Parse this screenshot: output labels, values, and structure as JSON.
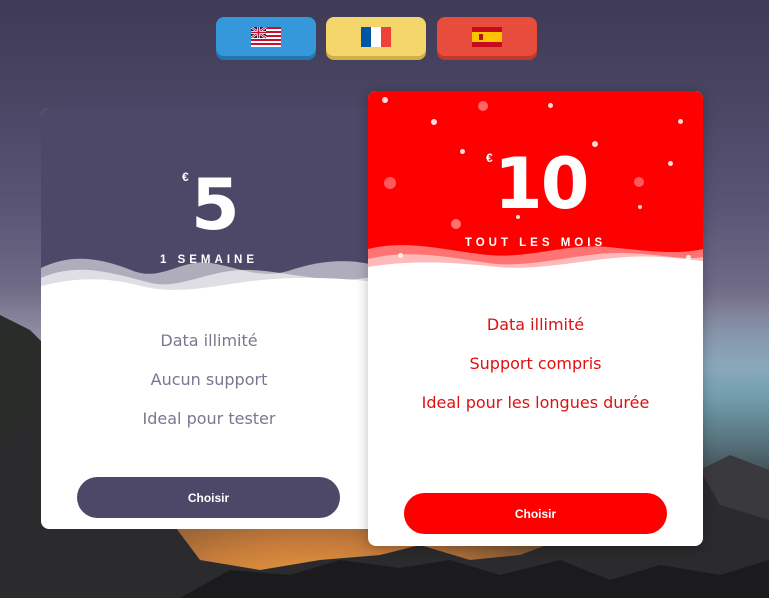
{
  "languages": [
    {
      "name": "English",
      "flag": "uk-us-flag-icon"
    },
    {
      "name": "Français",
      "flag": "france-flag-icon"
    },
    {
      "name": "Español",
      "flag": "spain-flag-icon"
    }
  ],
  "plans": {
    "basic": {
      "currency": "€",
      "price": "5",
      "period": "1 SEMAINE",
      "features": [
        "Data illimité",
        "Aucun support",
        "Ideal pour tester"
      ],
      "button_label": "Choisir",
      "color": "#4e4868"
    },
    "premium": {
      "currency": "€",
      "price": "10",
      "period": "TOUT LES MOIS",
      "features": [
        "Data illimité",
        "Support compris",
        "Ideal pour les longues durée"
      ],
      "button_label": "Choisir",
      "color": "#ff0000"
    }
  }
}
